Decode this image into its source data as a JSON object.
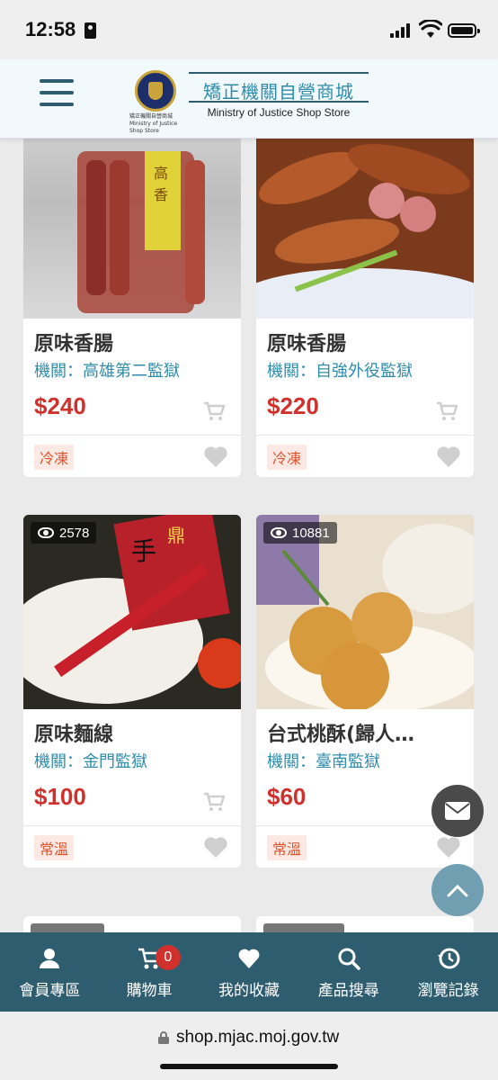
{
  "status_bar": {
    "time": "12:58"
  },
  "header": {
    "title": "矯正機關自營商城",
    "subtitle": "Ministry of Justice Shop Store",
    "emblem_text": "矯正機關自營商城 Ministry of Justice Shop Store"
  },
  "products": [
    {
      "title": "原味香腸",
      "agency": "機關：高雄第二監獄",
      "price": "$240",
      "tag": "冷凍",
      "views": ""
    },
    {
      "title": "原味香腸",
      "agency": "機關：自強外役監獄",
      "price": "$220",
      "tag": "冷凍",
      "views": ""
    },
    {
      "title": "原味麵線",
      "agency": "機關：金門監獄",
      "price": "$100",
      "tag": "常溫",
      "views": "2578"
    },
    {
      "title": "台式桃酥(歸人…",
      "agency": "機關：臺南監獄",
      "price": "$60",
      "tag": "常溫",
      "views": "10881"
    }
  ],
  "bottom_nav": {
    "member": "會員專區",
    "cart": "購物車",
    "cart_count": "0",
    "favorites": "我的收藏",
    "search": "產品搜尋",
    "history": "瀏覽記錄"
  },
  "browser": {
    "url": "shop.mjac.moj.gov.tw"
  },
  "colors": {
    "nav_bg": "#2f5d70",
    "accent": "#2f8cab",
    "price": "#d0312d",
    "tag": "#e0522d"
  }
}
